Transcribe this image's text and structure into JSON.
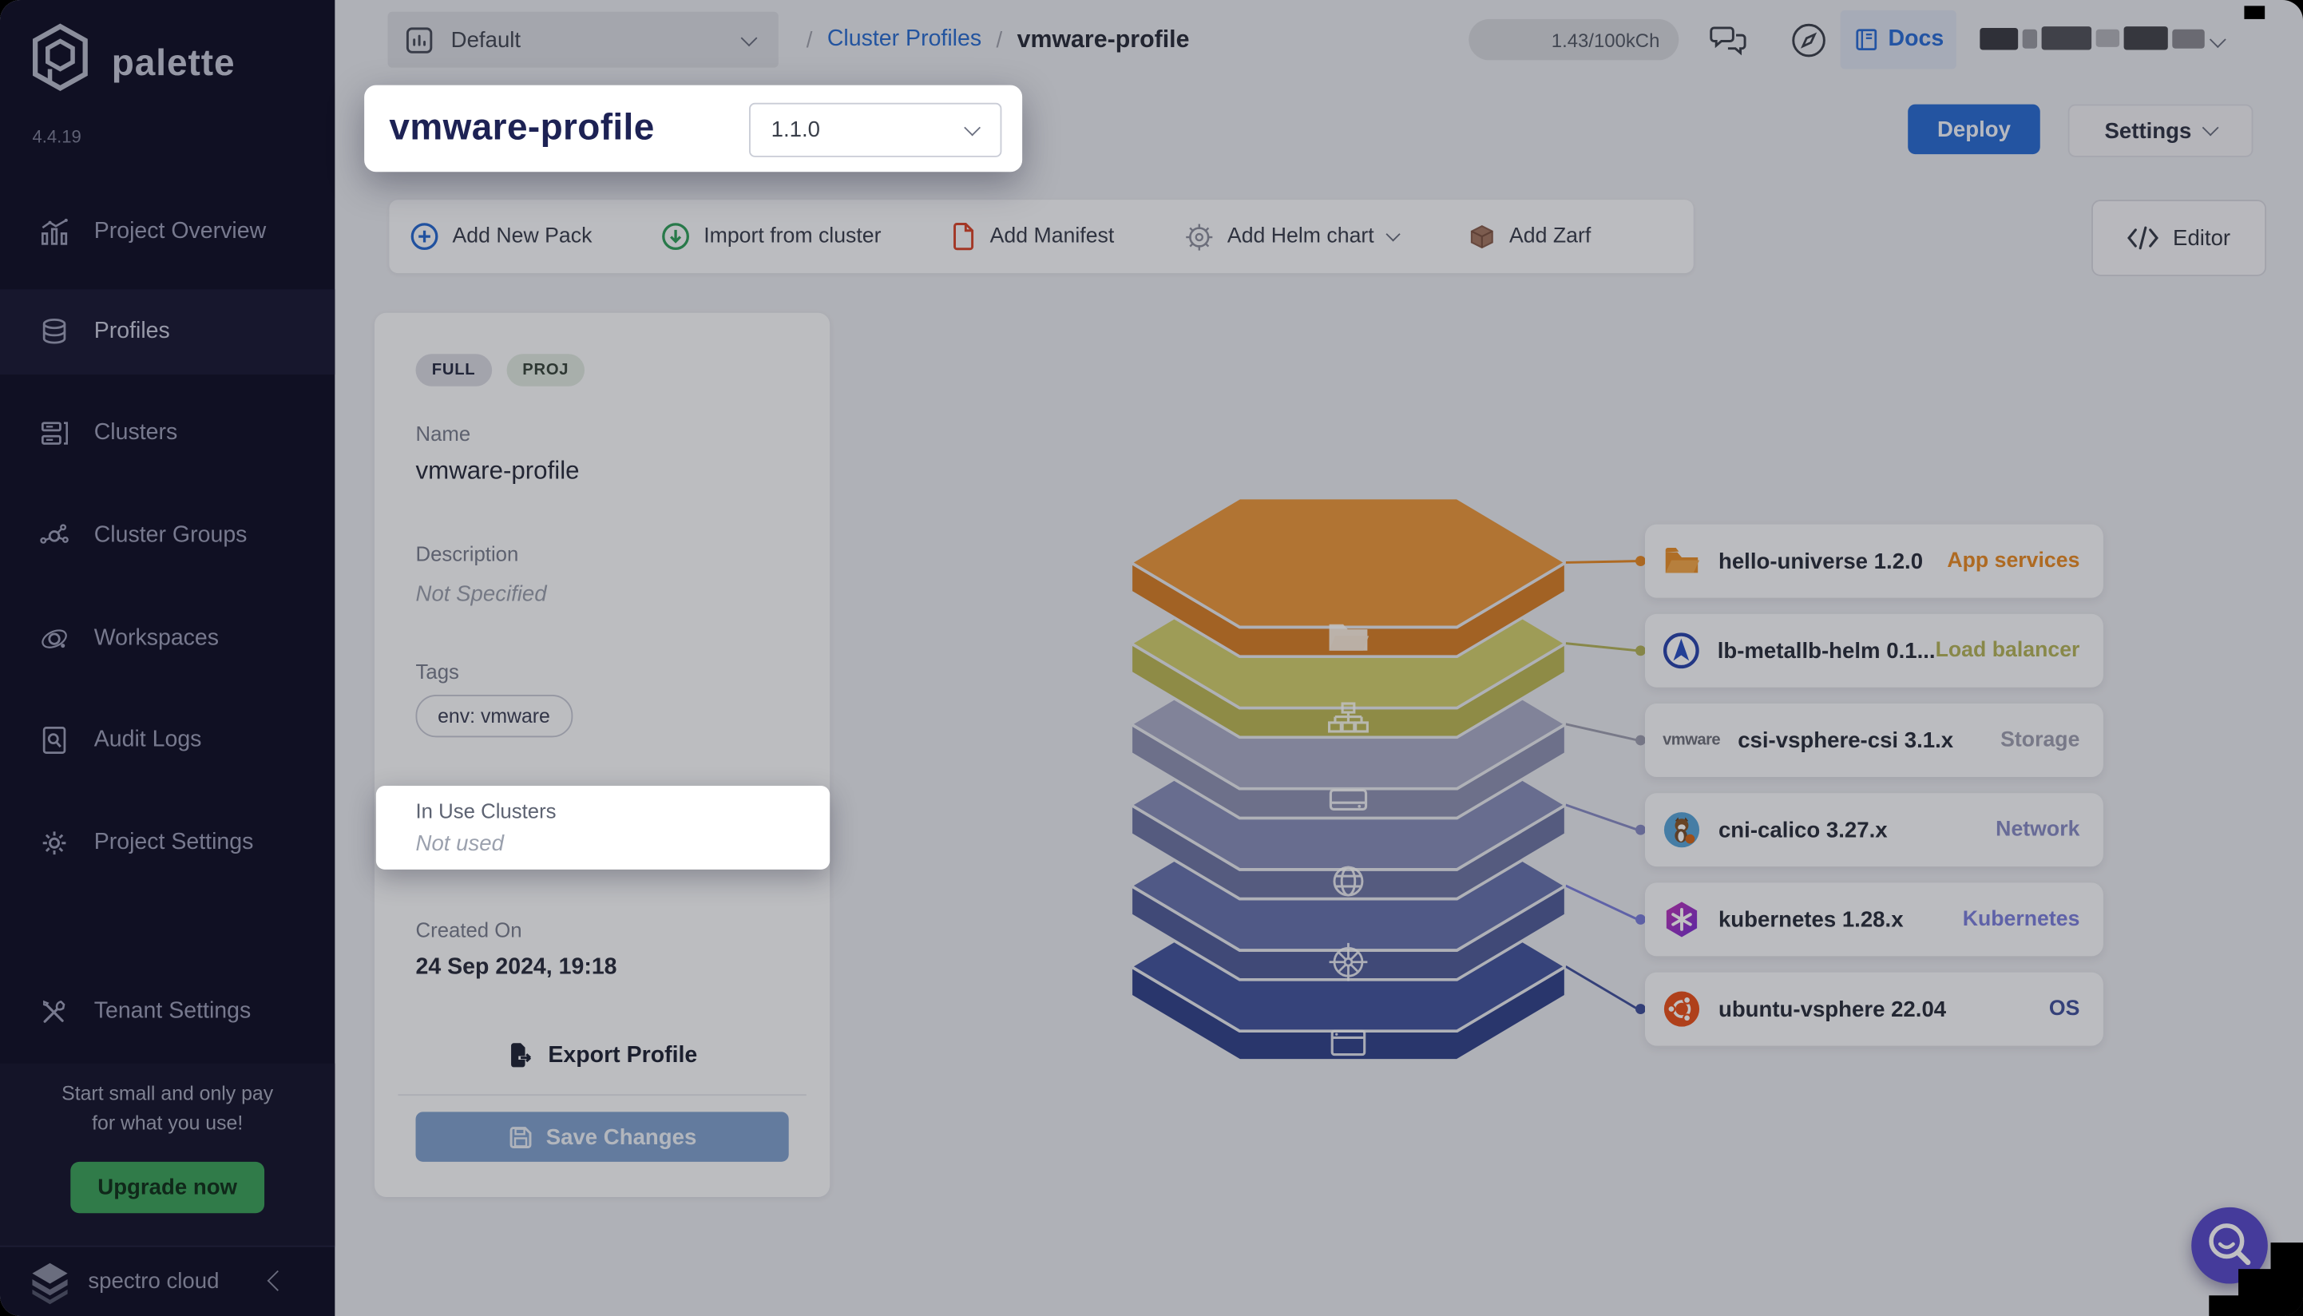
{
  "sidebar": {
    "brand": "palette",
    "version": "4.4.19",
    "items": [
      {
        "label": "Project Overview"
      },
      {
        "label": "Profiles"
      },
      {
        "label": "Clusters"
      },
      {
        "label": "Cluster Groups"
      },
      {
        "label": "Workspaces"
      },
      {
        "label": "Audit Logs"
      },
      {
        "label": "Project Settings"
      },
      {
        "label": "Tenant Settings"
      }
    ],
    "promo": {
      "line1": "Start small and only pay",
      "line2": "for what you use!",
      "cta": "Upgrade now"
    },
    "footer_brand": "spectro cloud"
  },
  "topbar": {
    "project": "Default",
    "sep": "/",
    "breadcrumb_link": "Cluster Profiles",
    "breadcrumb_current": "vmware-profile",
    "usage": "1.43/100kCh",
    "docs": "Docs"
  },
  "header": {
    "title": "vmware-profile",
    "version": "1.1.0",
    "deploy": "Deploy",
    "settings": "Settings"
  },
  "toolbar": {
    "add_pack": "Add New Pack",
    "import_cluster": "Import from cluster",
    "add_manifest": "Add Manifest",
    "add_helm": "Add Helm chart",
    "add_zarf": "Add Zarf",
    "editor": "Editor"
  },
  "panel": {
    "badge_full": "FULL",
    "badge_proj": "PROJ",
    "name_label": "Name",
    "name": "vmware-profile",
    "description_label": "Description",
    "description": "Not Specified",
    "tags_label": "Tags",
    "tag": "env: vmware",
    "in_use_label": "In Use Clusters",
    "in_use": "Not used",
    "created_label": "Created On",
    "created": "24 Sep 2024, 19:18",
    "export": "Export Profile",
    "save": "Save Changes"
  },
  "packs": [
    {
      "name": "hello-universe 1.2.0",
      "type": "App services",
      "accent": "#e78c2a",
      "icon": "folder-icon"
    },
    {
      "name": "lb-metallb-helm 0.1...",
      "type": "Load balancer",
      "accent": "#b5b55e",
      "icon": "metallb-icon"
    },
    {
      "name": "csi-vsphere-csi 3.1.x",
      "type": "Storage",
      "accent": "#9fa0b2",
      "icon": "vmware-icon",
      "icon_text": "vmware"
    },
    {
      "name": "cni-calico 3.27.x",
      "type": "Network",
      "accent": "#8a8ec6",
      "icon": "calico-cat-icon"
    },
    {
      "name": "kubernetes 1.28.x",
      "type": "Kubernetes",
      "accent": "#7e82dd",
      "icon": "kubernetes-icon"
    },
    {
      "name": "ubuntu-vsphere 22.04",
      "type": "OS",
      "accent": "#44549e",
      "icon": "ubuntu-icon"
    }
  ],
  "stack": {
    "layers": [
      {
        "top": "#eb9a41",
        "rim": "#d7822c"
      },
      {
        "top": "#d2cf70",
        "rim": "#bcb95a"
      },
      {
        "top": "#abaec9",
        "rim": "#9195b5"
      },
      {
        "top": "#8a91bb",
        "rim": "#7078a6"
      },
      {
        "top": "#6a76af",
        "rim": "#55619b"
      },
      {
        "top": "#47589f",
        "rim": "#36478d"
      }
    ]
  },
  "icons": {
    "project_selector": "bar-chart-icon",
    "chat": "chat-bubbles-icon",
    "help": "compass-icon",
    "docs": "book-icon",
    "fab": "search-smile-icon"
  },
  "colors": {
    "accent_blue": "#2e6fd3",
    "upgrade_green": "#3fa35e",
    "fab_purple": "#5b4ecb",
    "sidebar_bg": "#15152b"
  }
}
